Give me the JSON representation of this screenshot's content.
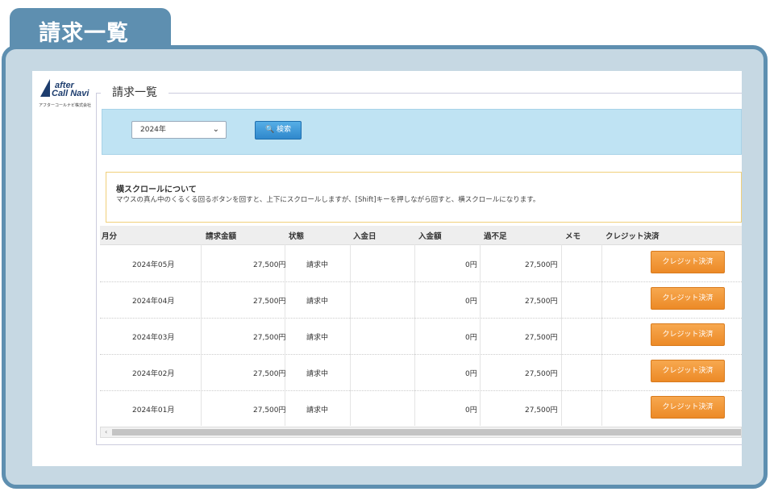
{
  "page_tab": {
    "title": "請求一覧"
  },
  "logo": {
    "line1": "after",
    "line2": "Call Navi",
    "company": "アフターコールナビ株式会社"
  },
  "section": {
    "title": "請求一覧"
  },
  "search": {
    "year_value": "2024年",
    "button_label": "検索"
  },
  "notice": {
    "title": "横スクロールについて",
    "text": "マウスの真ん中のくるくる回るボタンを回すと、上下にスクロールしますが、[Shift]キーを押しながら回すと、横スクロールになります。"
  },
  "table": {
    "columns": [
      "月分",
      "請求金額",
      "状態",
      "入金日",
      "入金額",
      "過不足",
      "メモ",
      "クレジット決済"
    ],
    "rows": [
      {
        "month": "2024年05月",
        "amount": "27,500円",
        "status": "請求中",
        "paid_date": "",
        "paid_amount": "0円",
        "balance": "27,500円",
        "memo": "",
        "action": "クレジット決済"
      },
      {
        "month": "2024年04月",
        "amount": "27,500円",
        "status": "請求中",
        "paid_date": "",
        "paid_amount": "0円",
        "balance": "27,500円",
        "memo": "",
        "action": "クレジット決済"
      },
      {
        "month": "2024年03月",
        "amount": "27,500円",
        "status": "請求中",
        "paid_date": "",
        "paid_amount": "0円",
        "balance": "27,500円",
        "memo": "",
        "action": "クレジット決済"
      },
      {
        "month": "2024年02月",
        "amount": "27,500円",
        "status": "請求中",
        "paid_date": "",
        "paid_amount": "0円",
        "balance": "27,500円",
        "memo": "",
        "action": "クレジット決済"
      },
      {
        "month": "2024年01月",
        "amount": "27,500円",
        "status": "請求中",
        "paid_date": "",
        "paid_amount": "0円",
        "balance": "27,500円",
        "memo": "",
        "action": "クレジット決済"
      }
    ]
  },
  "colors": {
    "frame": "#5e8fb0",
    "panel": "#bfe3f3",
    "pay_button": "#ec8a27",
    "notice_border": "#f0cf7a"
  },
  "icons": {
    "search": "search-icon",
    "dropdown": "chevron-down-icon",
    "scroll_left": "scroll-left-arrow-icon"
  }
}
